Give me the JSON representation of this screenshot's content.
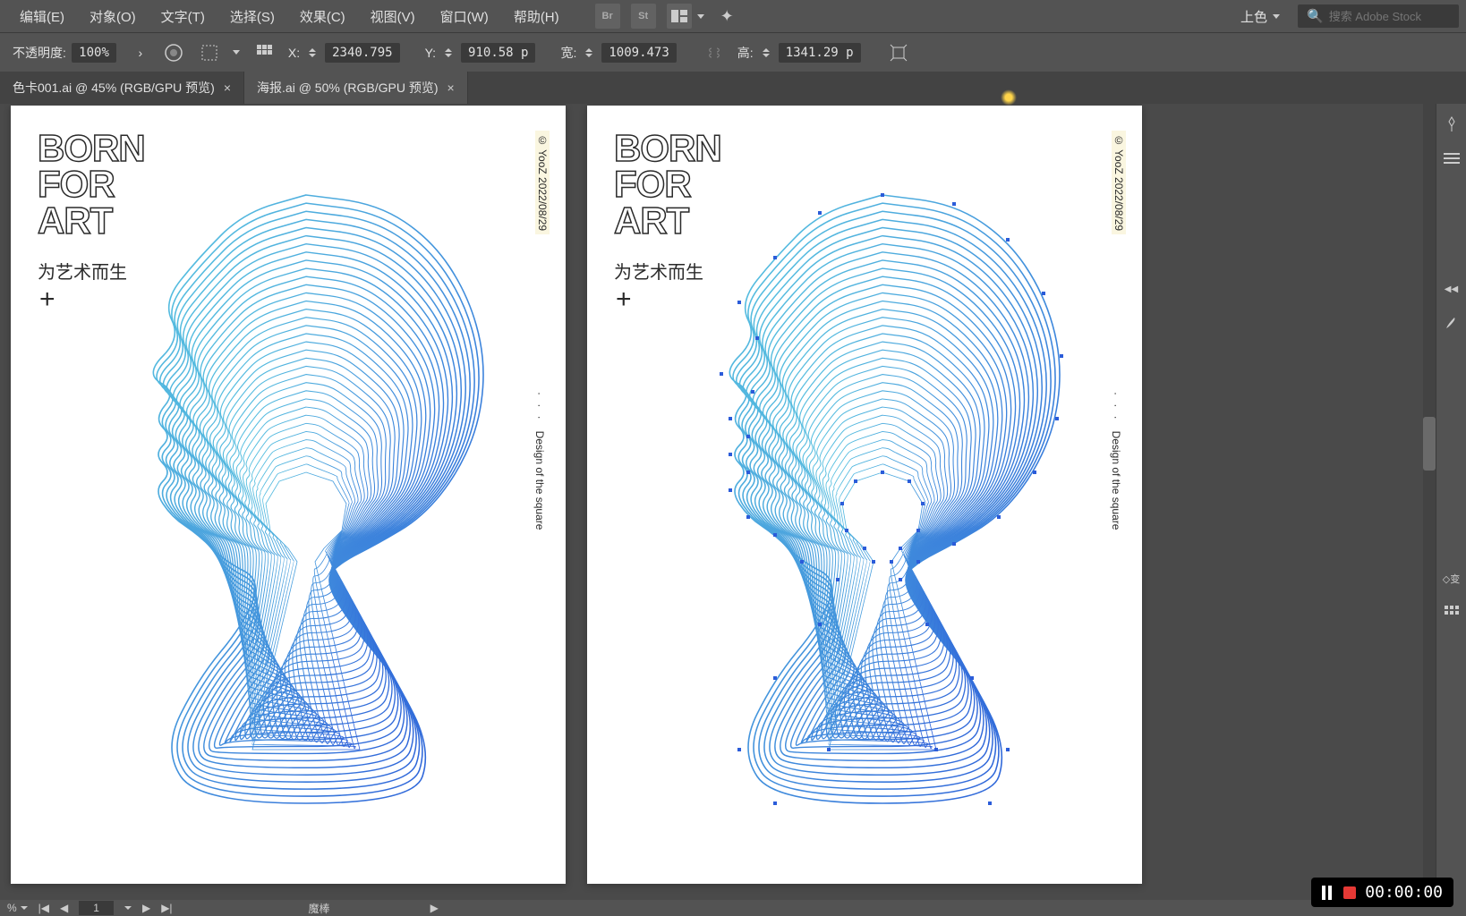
{
  "menu": {
    "items": [
      "编辑(E)",
      "对象(O)",
      "文字(T)",
      "选择(S)",
      "效果(C)",
      "视图(V)",
      "窗口(W)",
      "帮助(H)"
    ],
    "workspace": "上色",
    "search_placeholder": "搜索 Adobe Stock"
  },
  "options": {
    "opacity_label": "不透明度:",
    "opacity_value": "100%",
    "x_label": "X:",
    "x_value": "2340.795",
    "y_label": "Y:",
    "y_value": "910.58 p",
    "w_label": "宽:",
    "w_value": "1009.473",
    "h_label": "高:",
    "h_value": "1341.29 p"
  },
  "tabs": [
    {
      "label": "色卡001.ai @ 45% (RGB/GPU 预览)",
      "active": false
    },
    {
      "label": "海报.ai @ 50% (RGB/GPU 预览)",
      "active": true
    }
  ],
  "poster": {
    "line1": "BORN",
    "line2": "FOR",
    "line3": "ART",
    "sub": "为艺术而生",
    "plus": "+",
    "credit": "© YooZ   2022/08/29",
    "design_dots": "· · ·",
    "design_label": "Design of the square"
  },
  "rightpanel": {
    "transform_label": "变"
  },
  "status": {
    "zoom": "%",
    "page": "1",
    "tool": "魔棒"
  },
  "recorder": {
    "time": "00:00:00"
  }
}
